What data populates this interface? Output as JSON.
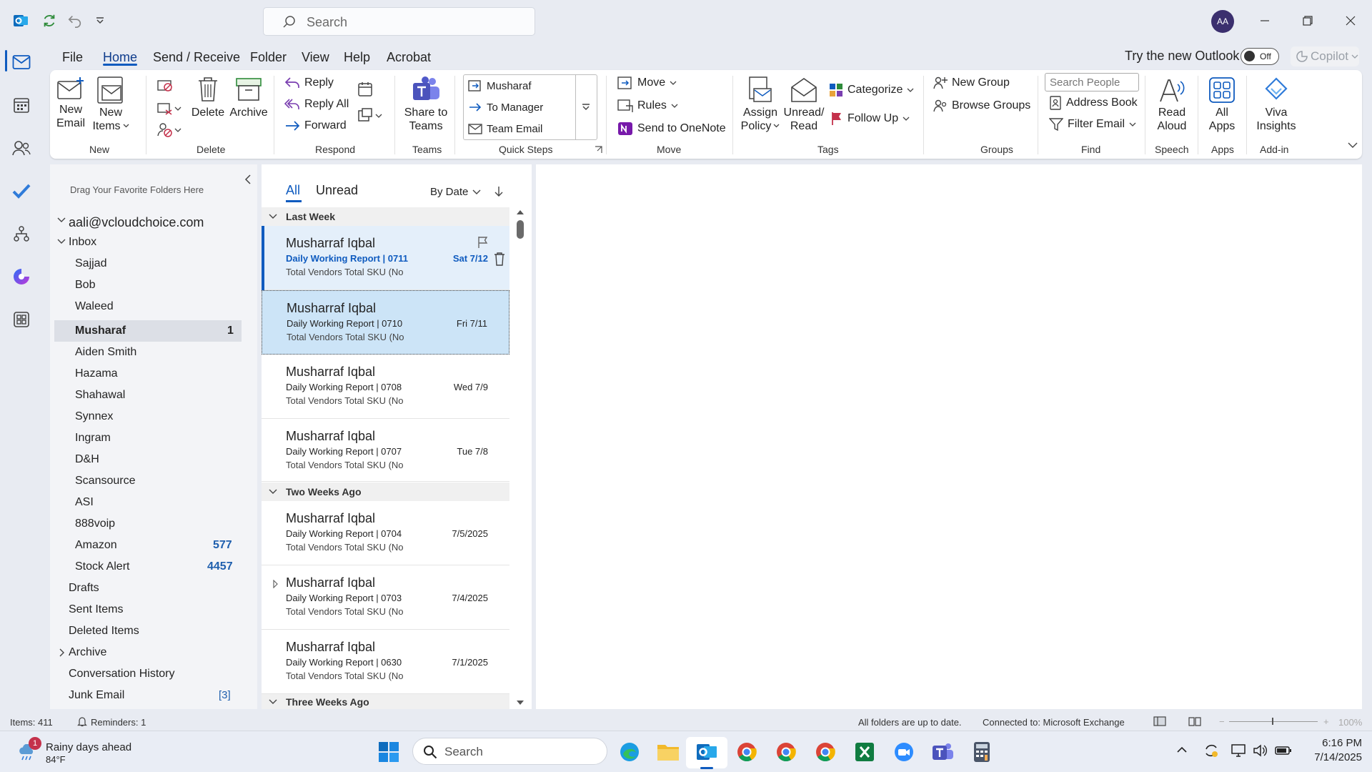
{
  "titlebar": {
    "search_placeholder": "Search",
    "avatar_initials": "AA"
  },
  "menu": {
    "tabs": [
      "File",
      "Home",
      "Send / Receive",
      "Folder",
      "View",
      "Help",
      "Acrobat"
    ],
    "try_new_outlook": "Try the new Outlook",
    "toggle_state": "Off",
    "copilot": "Copilot"
  },
  "ribbon": {
    "new": {
      "new_email": [
        "New",
        "Email"
      ],
      "new_items": [
        "New",
        "Items"
      ],
      "label": "New"
    },
    "delete": {
      "delete": "Delete",
      "archive": "Archive",
      "label": "Delete"
    },
    "respond": {
      "reply": "Reply",
      "reply_all": "Reply All",
      "forward": "Forward",
      "label": "Respond"
    },
    "teams": {
      "share": [
        "Share to",
        "Teams"
      ],
      "label": "Teams"
    },
    "quick_steps": {
      "items": [
        "Musharaf",
        "To Manager",
        "Team Email"
      ],
      "label": "Quick Steps"
    },
    "move": {
      "move": "Move",
      "rules": "Rules",
      "onenote": "Send to OneNote",
      "label": "Move"
    },
    "tags": {
      "assign_policy": [
        "Assign",
        "Policy"
      ],
      "unread_read": [
        "Unread/",
        "Read"
      ],
      "categorize": "Categorize",
      "follow_up": "Follow Up",
      "label": "Tags"
    },
    "groups": {
      "new_group": "New Group",
      "browse_groups": "Browse Groups",
      "label": "Groups"
    },
    "find": {
      "search_people": "Search People",
      "address_book": "Address Book",
      "filter_email": "Filter Email",
      "label": "Find"
    },
    "speech": {
      "read_aloud": [
        "Read",
        "Aloud"
      ],
      "label": "Speech"
    },
    "apps": {
      "all_apps": [
        "All",
        "Apps"
      ],
      "label": "Apps"
    },
    "addin": {
      "viva": [
        "Viva",
        "Insights"
      ],
      "label": "Add-in"
    }
  },
  "folders": {
    "drag_hint": "Drag Your Favorite Folders Here",
    "account": "aali@vcloudchoice.com",
    "inbox": "Inbox",
    "subfolders": [
      {
        "name": "Sajjad",
        "count": ""
      },
      {
        "name": "Bob",
        "count": ""
      },
      {
        "name": "Waleed",
        "count": ""
      },
      {
        "name": "Musharaf",
        "count": "1"
      },
      {
        "name": "Aiden Smith",
        "count": ""
      },
      {
        "name": "Hazama",
        "count": ""
      },
      {
        "name": "Shahawal",
        "count": ""
      },
      {
        "name": "Synnex",
        "count": ""
      },
      {
        "name": "Ingram",
        "count": ""
      },
      {
        "name": "D&H",
        "count": ""
      },
      {
        "name": "Scansource",
        "count": ""
      },
      {
        "name": "ASI",
        "count": ""
      },
      {
        "name": "888voip",
        "count": ""
      },
      {
        "name": "Amazon",
        "count": "577"
      },
      {
        "name": "Stock Alert",
        "count": "4457"
      }
    ],
    "top": [
      {
        "name": "Drafts",
        "count": ""
      },
      {
        "name": "Sent Items",
        "count": ""
      },
      {
        "name": "Deleted Items",
        "count": ""
      },
      {
        "name": "Archive",
        "count": ""
      },
      {
        "name": "Conversation History",
        "count": ""
      },
      {
        "name": "Junk Email",
        "count": "[3]"
      }
    ]
  },
  "message_list": {
    "filter_all": "All",
    "filter_unread": "Unread",
    "sort": "By Date",
    "groups": [
      "Last Week",
      "Two Weeks Ago",
      "Three Weeks Ago"
    ],
    "messages": [
      {
        "from": "Musharraf Iqbal",
        "subject": "Daily Working Report | 0711",
        "preview": "Total Vendors  Total SKU (No",
        "date": "Sat 7/12"
      },
      {
        "from": "Musharraf Iqbal",
        "subject": "Daily Working Report | 0710",
        "preview": "Total Vendors  Total SKU (No",
        "date": "Fri 7/11"
      },
      {
        "from": "Musharraf Iqbal",
        "subject": "Daily Working Report | 0708",
        "preview": "Total Vendors  Total SKU (No",
        "date": "Wed 7/9"
      },
      {
        "from": "Musharraf Iqbal",
        "subject": "Daily Working Report | 0707",
        "preview": "Total Vendors  Total SKU (No",
        "date": "Tue 7/8"
      },
      {
        "from": "Musharraf Iqbal",
        "subject": "Daily Working Report | 0704",
        "preview": "Total Vendors  Total SKU (No",
        "date": "7/5/2025"
      },
      {
        "from": "Musharraf Iqbal",
        "subject": "Daily Working Report | 0703",
        "preview": "Total Vendors  Total SKU (No",
        "date": "7/4/2025"
      },
      {
        "from": "Musharraf Iqbal",
        "subject": "Daily Working Report | 0630",
        "preview": "Total Vendors  Total SKU (No",
        "date": "7/1/2025"
      }
    ]
  },
  "status": {
    "items": "Items: 411",
    "reminders": "Reminders: 1",
    "sync": "All folders are up to date.",
    "connection": "Connected to: Microsoft Exchange",
    "zoom": "100%"
  },
  "taskbar": {
    "weather_title": "Rainy days ahead",
    "weather_temp": "84°F",
    "weather_badge": "1",
    "search_placeholder": "Search",
    "time": "6:16 PM",
    "date": "7/14/2025"
  },
  "colors": {
    "accent": "#0f5bbf",
    "selected_row": "#cce4f7",
    "count_blue": "#1f5fae"
  }
}
